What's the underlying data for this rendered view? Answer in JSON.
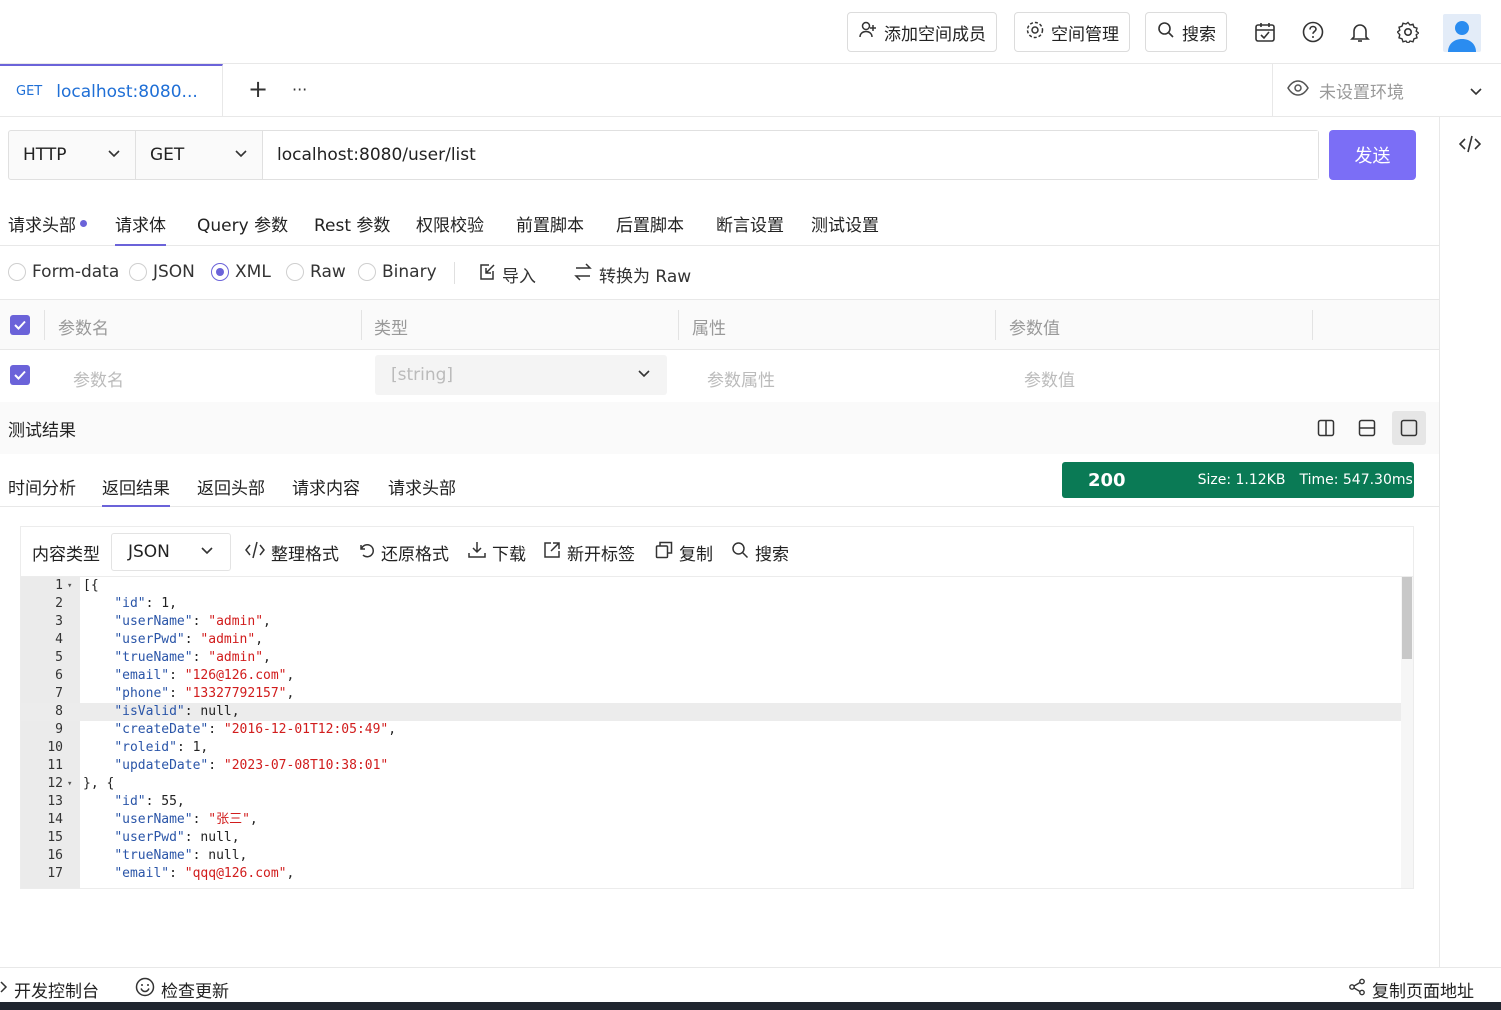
{
  "header": {
    "add_member": "添加空间成员",
    "space_manage": "空间管理",
    "search": "搜索"
  },
  "tabs": {
    "active": {
      "method": "GET",
      "title": "localhost:8080..."
    },
    "add": "+",
    "more": "···",
    "env": "未设置环境"
  },
  "request": {
    "protocol": "HTTP",
    "method": "GET",
    "url": "localhost:8080/user/list",
    "send": "发送"
  },
  "req_tabs": [
    "请求头部",
    "请求体",
    "Query 参数",
    "Rest 参数",
    "权限校验",
    "前置脚本",
    "后置脚本",
    "断言设置",
    "测试设置"
  ],
  "body_types": [
    "Form-data",
    "JSON",
    "XML",
    "Raw",
    "Binary"
  ],
  "body_actions": {
    "import": "导入",
    "to_raw": "转换为 Raw"
  },
  "params": {
    "headers": [
      "参数名",
      "类型",
      "属性",
      "参数值"
    ],
    "row": {
      "name": "参数名",
      "type": "[string]",
      "attr": "参数属性",
      "value": "参数值"
    }
  },
  "result": {
    "title": "测试结果",
    "tabs": [
      "时间分析",
      "返回结果",
      "返回头部",
      "请求内容",
      "请求头部"
    ],
    "status_code": "200",
    "size": "Size:  1.12KB",
    "time": "Time:  547.30ms"
  },
  "editor": {
    "content_type_label": "内容类型",
    "content_type": "JSON",
    "tools": [
      "整理格式",
      "还原格式",
      "下载",
      "新开标签",
      "复制",
      "搜索"
    ],
    "lines": [
      {
        "n": "1",
        "text": "[{"
      },
      {
        "n": "2",
        "text": "    \"id\": 1,"
      },
      {
        "n": "3",
        "text": "    \"userName\": \"admin\","
      },
      {
        "n": "4",
        "text": "    \"userPwd\": \"admin\","
      },
      {
        "n": "5",
        "text": "    \"trueName\": \"admin\","
      },
      {
        "n": "6",
        "text": "    \"email\": \"126@126.com\","
      },
      {
        "n": "7",
        "text": "    \"phone\": \"13327792157\","
      },
      {
        "n": "8",
        "text": "    \"isValid\": null,"
      },
      {
        "n": "9",
        "text": "    \"createDate\": \"2016-12-01T12:05:49\","
      },
      {
        "n": "10",
        "text": "    \"roleid\": 1,"
      },
      {
        "n": "11",
        "text": "    \"updateDate\": \"2023-07-08T10:38:01\""
      },
      {
        "n": "12",
        "text": "}, {"
      },
      {
        "n": "13",
        "text": "    \"id\": 55,"
      },
      {
        "n": "14",
        "text": "    \"userName\": \"张三\","
      },
      {
        "n": "15",
        "text": "    \"userPwd\": null,"
      },
      {
        "n": "16",
        "text": "    \"trueName\": null,"
      },
      {
        "n": "17",
        "text": "    \"email\": \"qqq@126.com\","
      }
    ]
  },
  "footer": {
    "devconsole": "开发控制台",
    "check_update": "检查更新",
    "copy_url": "复制页面地址"
  },
  "colors": {
    "accent": "#6b63d9",
    "send": "#7b6ef6",
    "status_ok": "#0a7a55"
  }
}
